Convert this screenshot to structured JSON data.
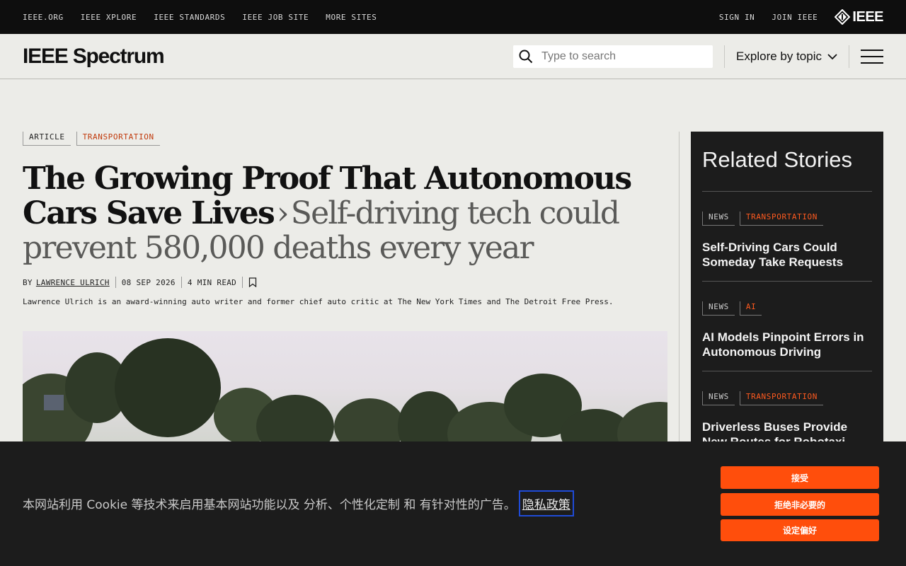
{
  "topbar": {
    "links": [
      "IEEE.ORG",
      "IEEE XPLORE",
      "IEEE STANDARDS",
      "IEEE JOB SITE",
      "MORE SITES"
    ],
    "sign_in": "SIGN IN",
    "join": "JOIN IEEE",
    "logo_text": "IEEE"
  },
  "header": {
    "brand": "IEEE Spectrum",
    "search_placeholder": "Type to search",
    "explore": "Explore by topic"
  },
  "article": {
    "tags": [
      "ARTICLE",
      "TRANSPORTATION"
    ],
    "title": "The Growing Proof That Autonomous Cars Save Lives",
    "subtitle": "Self-driving tech could prevent 580,000 deaths every year",
    "by": "BY",
    "author": "LAWRENCE ULRICH",
    "date": "08 SEP 2026",
    "read_time": "4 MIN READ",
    "bio": "Lawrence Ulrich is an award-winning auto writer and former chief auto critic at The New York Times and The Detroit Free Press."
  },
  "related": {
    "heading": "Related Stories",
    "stories": [
      {
        "type": "NEWS",
        "topic": "TRANSPORTATION",
        "title": "Self-Driving Cars Could Someday Take Requests"
      },
      {
        "type": "NEWS",
        "topic": "AI",
        "title": "AI Models Pinpoint Errors in Autonomous Driving"
      },
      {
        "type": "NEWS",
        "topic": "TRANSPORTATION",
        "title": "Driverless Buses Provide New Routes for Robotaxi"
      }
    ]
  },
  "cookie": {
    "message": "本网站利用 Cookie 等技术来启用基本网站功能以及 分析、个性化定制 和 有针对性的广告。",
    "policy": "隐私政策",
    "accept": "接受",
    "reject": "拒绝非必要的",
    "preferences": "设定偏好"
  },
  "colors": {
    "accent": "#ff4e0c",
    "tag_orange": "#c0390b",
    "dark_panel": "#1c1c1c"
  }
}
